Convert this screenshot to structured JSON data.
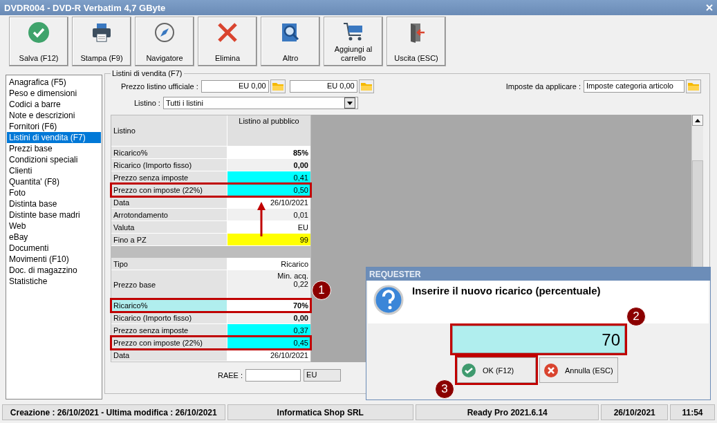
{
  "window": {
    "title": "DVDR004 - DVD-R Verbatim 4,7 GByte"
  },
  "toolbar": [
    {
      "label": "Salva (F12)",
      "kind": "check"
    },
    {
      "label": "Stampa (F9)",
      "kind": "printer"
    },
    {
      "label": "Navigatore",
      "kind": "compass"
    },
    {
      "label": "Elimina",
      "kind": "cross"
    },
    {
      "label": "Altro",
      "kind": "magnifier"
    },
    {
      "label": "Aggiungi al carrello",
      "kind": "cart"
    },
    {
      "label": "Uscita (ESC)",
      "kind": "exit"
    }
  ],
  "sidebar": {
    "items": [
      {
        "label": "Anagrafica (F5)",
        "selected": false
      },
      {
        "label": "Peso e dimensioni",
        "selected": false
      },
      {
        "label": "Codici a barre",
        "selected": false
      },
      {
        "label": "Note e descrizioni",
        "selected": false
      },
      {
        "label": "Fornitori (F6)",
        "selected": false
      },
      {
        "label": "Listini di vendita (F7)",
        "selected": true
      },
      {
        "label": "Prezzi base",
        "selected": false
      },
      {
        "label": "Condizioni speciali",
        "selected": false
      },
      {
        "label": "Clienti",
        "selected": false
      },
      {
        "label": "Quantita' (F8)",
        "selected": false
      },
      {
        "label": "Foto",
        "selected": false
      },
      {
        "label": "Distinta base",
        "selected": false
      },
      {
        "label": "Distinte base madri",
        "selected": false
      },
      {
        "label": "Web",
        "selected": false
      },
      {
        "label": "eBay",
        "selected": false
      },
      {
        "label": "Documenti",
        "selected": false
      },
      {
        "label": "Movimenti (F10)",
        "selected": false
      },
      {
        "label": "Doc. di magazzino",
        "selected": false
      },
      {
        "label": "Statistiche",
        "selected": false
      }
    ]
  },
  "listini": {
    "title": "Listini di vendita (F7)",
    "prezzo_label": "Prezzo listino ufficiale :",
    "prezzo_fields": [
      "EU 0,00",
      "EU 0,00"
    ],
    "imposte_label": "Imposte da applicare :",
    "imposte_value": "Imposte categoria articolo",
    "listino_label": "Listino :",
    "listino_value": "Tutti i listini",
    "table": {
      "header": {
        "label": "Listino",
        "value": "Listino al pubblico"
      },
      "rows": [
        {
          "kind": "row",
          "label": "Ricarico%",
          "value": "85%",
          "color": "#ffffff",
          "bold": true,
          "selected": false,
          "highlighted": false
        },
        {
          "kind": "row",
          "label": "Ricarico (Importo fisso)",
          "value": "0,00",
          "color": "#f0f0f0",
          "bold": true,
          "selected": false,
          "highlighted": false
        },
        {
          "kind": "row",
          "label": "Prezzo senza imposte",
          "value": "0,41",
          "color": "#00ffff",
          "bold": false,
          "selected": false,
          "highlighted": false
        },
        {
          "kind": "row",
          "label": "Prezzo con imposte (22%)",
          "value": "0,50",
          "color": "#00ffff",
          "bold": false,
          "selected": false,
          "highlighted": true
        },
        {
          "kind": "row",
          "label": "Data",
          "value": "26/10/2021",
          "color": "#ffffff",
          "bold": false,
          "selected": false,
          "highlighted": false
        },
        {
          "kind": "row",
          "label": "Arrotondamento",
          "value": "0,01",
          "color": "#f0f0f0",
          "bold": false,
          "selected": false,
          "highlighted": false
        },
        {
          "kind": "row",
          "label": "Valuta",
          "value": "EU",
          "color": "#ffffff",
          "bold": false,
          "selected": false,
          "highlighted": false
        },
        {
          "kind": "row",
          "label": "Fino a PZ",
          "value": "99",
          "color": "#ffff00",
          "bold": false,
          "selected": false,
          "highlighted": false
        },
        {
          "kind": "spacer"
        },
        {
          "kind": "row",
          "label": "Tipo",
          "value": "Ricarico",
          "color": "#ffffff",
          "bold": false,
          "selected": false,
          "highlighted": false
        },
        {
          "kind": "tall",
          "label": "Prezzo base",
          "value_lines": [
            "Min. acq.",
            "0,22"
          ],
          "color": "#f0f0f0",
          "bold": false,
          "selected": false,
          "highlighted": false
        },
        {
          "kind": "row",
          "label": "Ricarico%",
          "value": "70%",
          "color": "#ffffff",
          "bold": true,
          "selected": true,
          "highlighted": true
        },
        {
          "kind": "row",
          "label": "Ricarico (Importo fisso)",
          "value": "0,00",
          "color": "#f0f0f0",
          "bold": true,
          "selected": false,
          "highlighted": false
        },
        {
          "kind": "row",
          "label": "Prezzo senza imposte",
          "value": "0,37",
          "color": "#00ffff",
          "bold": false,
          "selected": false,
          "highlighted": false
        },
        {
          "kind": "row",
          "label": "Prezzo con imposte (22%)",
          "value": "0,45",
          "color": "#00ffff",
          "bold": false,
          "selected": false,
          "highlighted": true
        },
        {
          "kind": "row",
          "label": "Data",
          "value": "26/10/2021",
          "color": "#ffffff",
          "bold": false,
          "selected": false,
          "highlighted": false
        }
      ]
    },
    "raee_label": "RAEE :",
    "raee_currency": "EU"
  },
  "dialog": {
    "title": "REQUESTER",
    "message": "Inserire il nuovo ricarico (percentuale)",
    "value": "70",
    "highlighted": true,
    "buttons": [
      {
        "label": "OK (F12)",
        "kind": "ok",
        "highlighted": true
      },
      {
        "label": "Annulla (ESC)",
        "kind": "cancel",
        "highlighted": false
      }
    ]
  },
  "annotations": [
    {
      "number": "1"
    },
    {
      "number": "2"
    },
    {
      "number": "3"
    }
  ],
  "status_bar": [
    "Creazione : 26/10/2021 - Ultima modifica : 26/10/2021",
    "Informatica Shop SRL",
    "Ready Pro 2021.6.14",
    "26/10/2021",
    "11:54"
  ]
}
